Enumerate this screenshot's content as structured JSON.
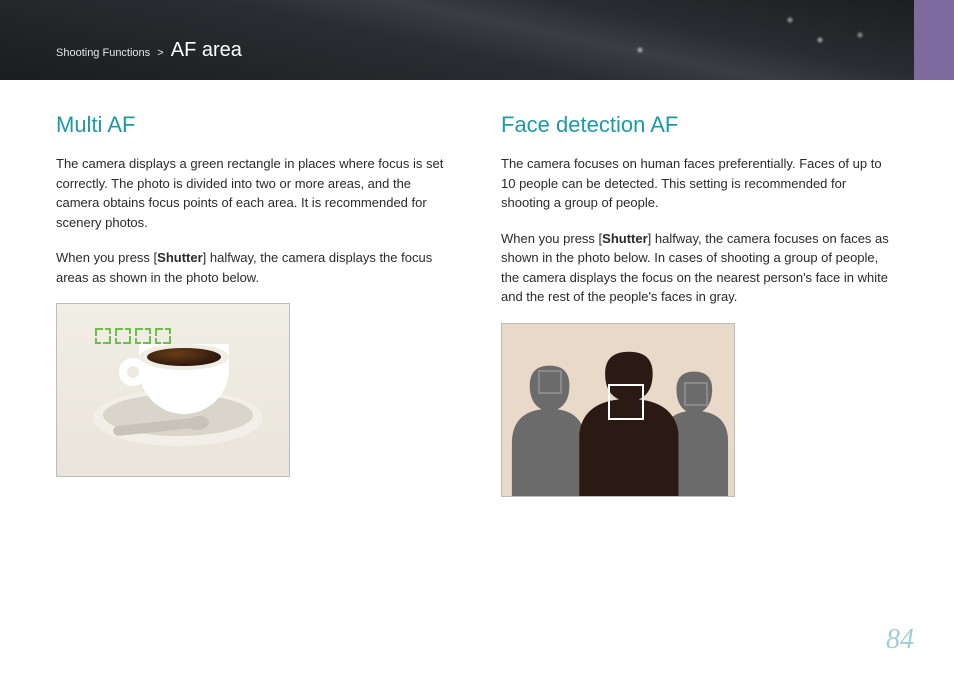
{
  "header": {
    "breadcrumb_parent": "Shooting Functions",
    "breadcrumb_sep": ">",
    "breadcrumb_current": "AF area"
  },
  "left": {
    "heading": "Multi AF",
    "p1": "The camera displays a green rectangle in places where focus is set correctly. The photo is divided into two or more areas, and the camera obtains focus points of each area. It is recommended for scenery photos.",
    "p2a": "When you press [",
    "shutter": "Shutter",
    "p2b": "] halfway, the camera displays the focus areas as shown in the photo below."
  },
  "right": {
    "heading": "Face detection AF",
    "p1": "The camera focuses on human faces preferentially. Faces of up to 10 people can be detected. This setting is recommended for shooting a group of people.",
    "p2a": "When you press [",
    "shutter": "Shutter",
    "p2b": "] halfway, the camera focuses on faces as shown in the photo below. In cases of shooting a group of people, the camera displays the focus on the nearest person's face in white and the rest of the people's faces in gray."
  },
  "page_number": "84",
  "colors": {
    "accent": "#1f9aa4",
    "focus_green": "#6cbf4b",
    "focus_white": "#ffffff",
    "focus_gray": "#8a8a8a",
    "tab": "#7f6a9e"
  }
}
